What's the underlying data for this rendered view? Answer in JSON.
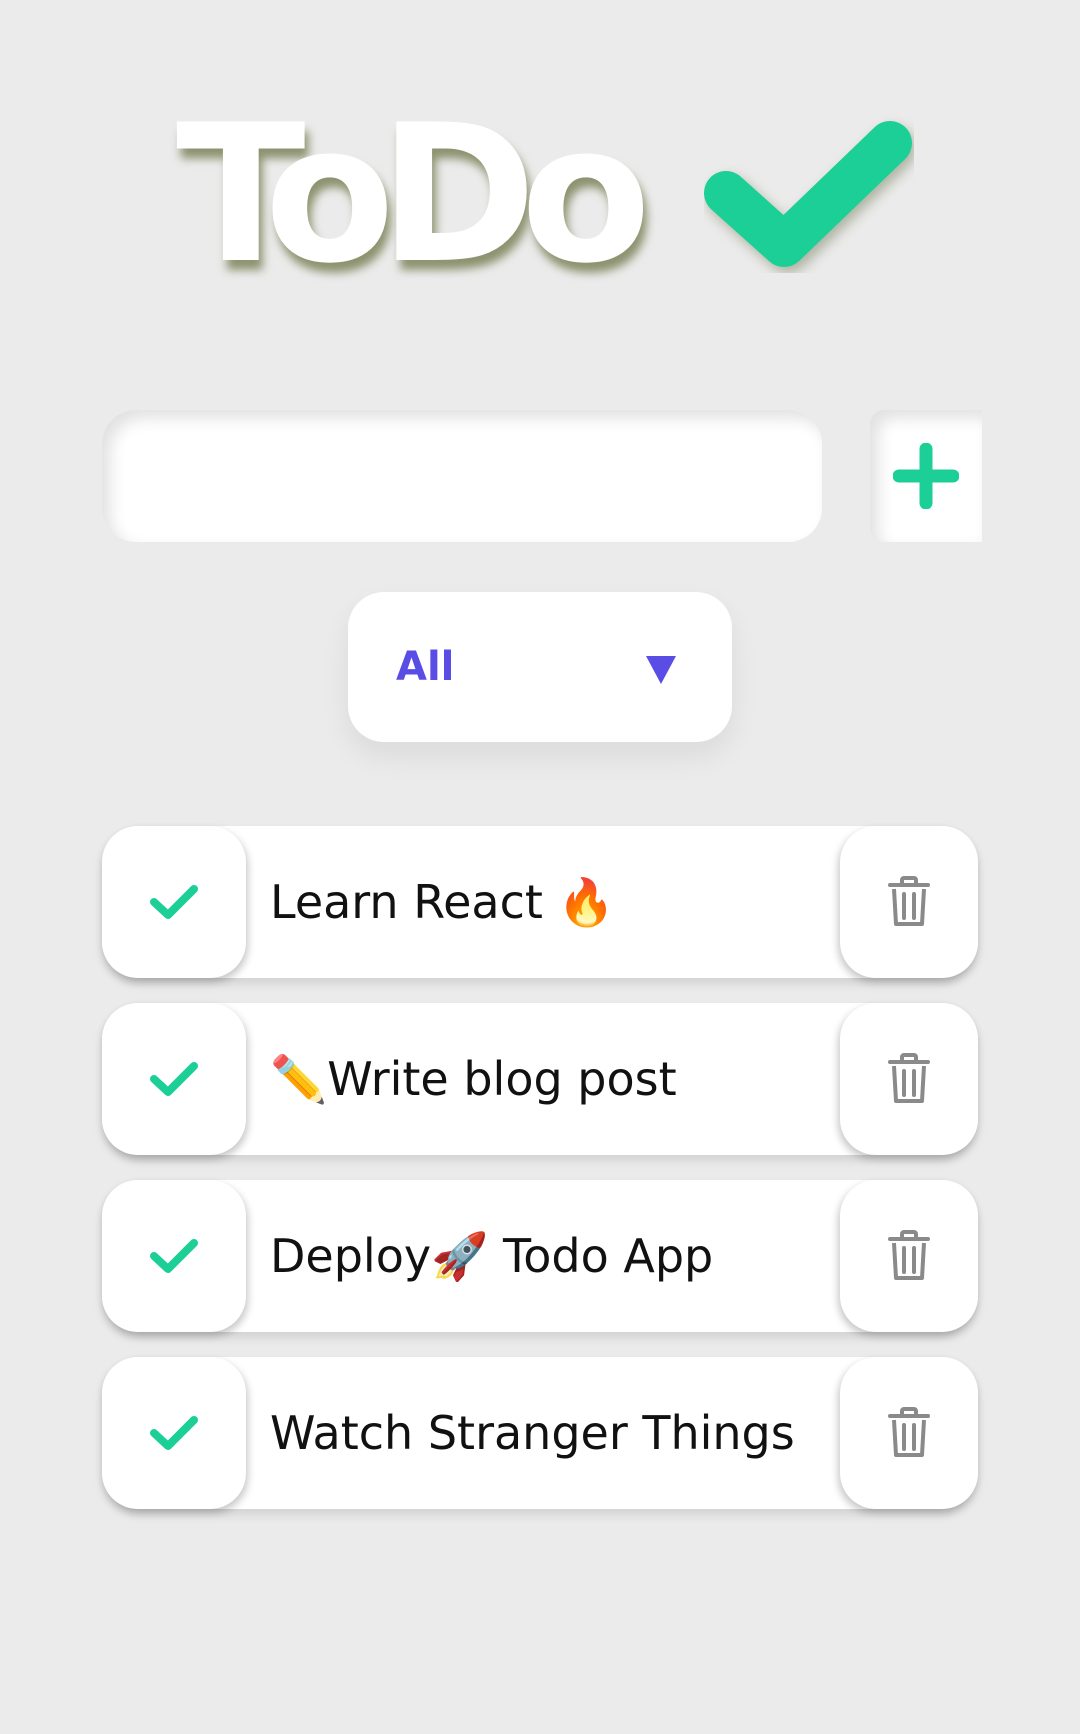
{
  "app": {
    "title": "ToDo"
  },
  "input": {
    "value": "",
    "placeholder": ""
  },
  "filter": {
    "selected": "All"
  },
  "todos": [
    {
      "text": "Learn React 🔥"
    },
    {
      "text": "✏️Write blog post"
    },
    {
      "text": "Deploy🚀 Todo App"
    },
    {
      "text": "Watch Stranger Things"
    }
  ],
  "icons": {
    "title_check": "check-icon",
    "add": "plus-icon",
    "filter_caret": "caret-down-icon",
    "complete": "check-icon",
    "delete": "trash-icon"
  },
  "colors": {
    "background": "#ebebeb",
    "accent_green": "#1ccf97",
    "filter_text": "#5a4de6",
    "trash_gray": "#8a8a8a",
    "title_text": "#ffffff"
  }
}
